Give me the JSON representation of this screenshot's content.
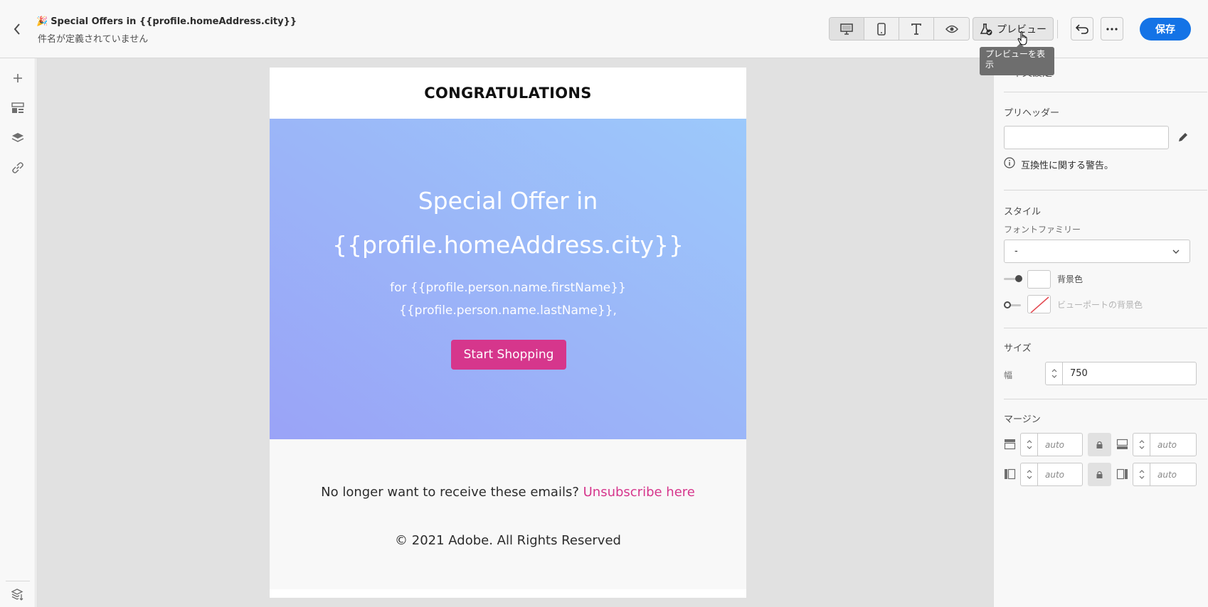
{
  "header": {
    "title_emoji": "🎉",
    "title": "Special Offers in {{profile.homeAddress.city}}",
    "subtitle": "件名が定義されていません",
    "preview_label": "プレビュー",
    "save_label": "保存",
    "tooltip": "プレビューを表示"
  },
  "email": {
    "heading": "CONGRATULATIONS",
    "hero_title_line1": "Special Offer in",
    "hero_title_line2": "{{profile.homeAddress.city}}",
    "hero_sub_line1": "for {{profile.person.name.firstName}}",
    "hero_sub_line2": "{{profile.person.name.lastName}},",
    "button_label": "Start Shopping",
    "unsubscribe_text": "No longer want to receive these emails? ",
    "unsubscribe_link": "Unsubscribe here",
    "copyright": "© 2021 Adobe. All Rights Reserved"
  },
  "panel": {
    "section_title": "本文設定",
    "preheader_label": "プリヘッダー",
    "preheader_value": "",
    "compat_warning": "互換性に関する警告。",
    "style_label": "スタイル",
    "font_family_label": "フォントファミリー",
    "font_family_value": "-",
    "bg_color_label": "背景色",
    "viewport_bg_label": "ビューポートの背景色",
    "size_label": "サイズ",
    "width_label": "幅",
    "width_value": "750",
    "margin_label": "マージン",
    "margin_top": "auto",
    "margin_bottom": "auto",
    "margin_left": "auto",
    "margin_right": "auto"
  },
  "colors": {
    "accent": "#1473e6",
    "cta": "#d6368c",
    "hero_start": "#9aa3f7",
    "hero_end": "#9cc9fb"
  }
}
